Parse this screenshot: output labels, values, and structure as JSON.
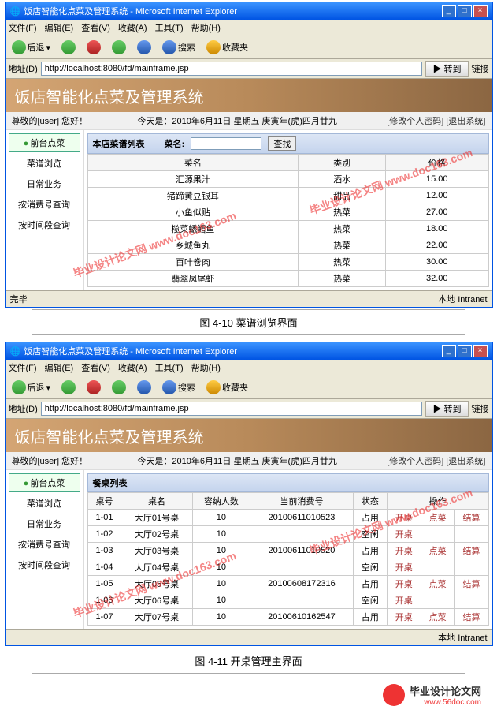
{
  "figure1": {
    "caption": "图 4-10 菜谱浏览界面",
    "window": {
      "title": "饭店智能化点菜及管理系统 - Microsoft Internet Explorer",
      "menu": [
        "文件(F)",
        "编辑(E)",
        "查看(V)",
        "收藏(A)",
        "工具(T)",
        "帮助(H)"
      ],
      "toolbar": {
        "back": "后退",
        "forward": "",
        "stop": "",
        "refresh": "",
        "home": "",
        "search": "搜索",
        "fav": "收藏夹"
      },
      "address_label": "地址(D)",
      "address": "http://localhost:8080/fd/mainframe.jsp",
      "go": "转到",
      "links": "链接",
      "status_left": "完毕",
      "status_right": "本地 Intranet"
    },
    "banner": "饭店智能化点菜及管理系统",
    "info": {
      "left": "尊敬的[user] 您好！",
      "center": "今天是：2010年6月11日 星期五 庚寅年(虎)四月廿九",
      "right_pwd": "[修改个人密码]",
      "right_exit": "[退出系统]"
    },
    "sidebar": [
      "前台点菜",
      "菜谱浏览",
      "日常业务",
      "按消费号查询",
      "按时间段查询"
    ],
    "panel": {
      "title": "本店菜谱列表",
      "search_label": "菜名:",
      "search_btn": "查找"
    },
    "table1": {
      "headers": [
        "菜名",
        "类别",
        "价格"
      ],
      "rows": [
        [
          "汇源果汁",
          "酒水",
          "15.00"
        ],
        [
          "猪蹄黄豆银耳",
          "甜品",
          "12.00"
        ],
        [
          "小鱼似贴",
          "热菜",
          "27.00"
        ],
        [
          "榄菜蟋鳕鱼",
          "热菜",
          "18.00"
        ],
        [
          "乡城鱼丸",
          "热菜",
          "22.00"
        ],
        [
          "百叶卷肉",
          "热菜",
          "30.00"
        ],
        [
          "翡翠凤尾虾",
          "热菜",
          "32.00"
        ]
      ]
    }
  },
  "figure2": {
    "caption": "图 4-11 开桌管理主界面",
    "window": {
      "title": "饭店智能化点菜及管理系统 - Microsoft Internet Explorer",
      "menu": [
        "文件(F)",
        "编辑(E)",
        "查看(V)",
        "收藏(A)",
        "工具(T)",
        "帮助(H)"
      ],
      "toolbar": {
        "back": "后退",
        "forward": "",
        "stop": "",
        "refresh": "",
        "home": "",
        "search": "搜索",
        "fav": "收藏夹"
      },
      "address_label": "地址(D)",
      "address": "http://localhost:8080/fd/mainframe.jsp",
      "go": "转到",
      "links": "链接",
      "status_left": "",
      "status_right": "本地 Intranet"
    },
    "banner": "饭店智能化点菜及管理系统",
    "info": {
      "left": "尊敬的[user] 您好！",
      "center": "今天是：2010年6月11日 星期五 庚寅年(虎)四月廿九",
      "right_pwd": "[修改个人密码]",
      "right_exit": "[退出系统]"
    },
    "sidebar": [
      "前台点菜",
      "菜谱浏览",
      "日常业务",
      "按消费号查询",
      "按时间段查询"
    ],
    "panel": {
      "title": "餐桌列表"
    },
    "table2": {
      "headers": [
        "桌号",
        "桌名",
        "容纳人数",
        "当前消费号",
        "状态",
        "操作",
        "",
        ""
      ],
      "rows": [
        [
          "1-01",
          "大厅01号桌",
          "10",
          "20100611010523",
          "占用",
          "开桌",
          "点菜",
          "结算"
        ],
        [
          "1-02",
          "大厅02号桌",
          "10",
          "",
          "空闲",
          "开桌",
          "",
          ""
        ],
        [
          "1-03",
          "大厅03号桌",
          "10",
          "20100611010520",
          "占用",
          "开桌",
          "点菜",
          "结算"
        ],
        [
          "1-04",
          "大厅04号桌",
          "10",
          "",
          "空闲",
          "开桌",
          "",
          ""
        ],
        [
          "1-05",
          "大厅05号桌",
          "10",
          "20100608172316",
          "占用",
          "开桌",
          "点菜",
          "结算"
        ],
        [
          "1-06",
          "大厅06号桌",
          "10",
          "",
          "空闲",
          "开桌",
          "",
          ""
        ],
        [
          "1-07",
          "大厅07号桌",
          "10",
          "20100610162547",
          "占用",
          "开桌",
          "点菜",
          "结算"
        ]
      ]
    }
  },
  "watermarks": {
    "w1": "毕业设计论文网\nwww.doc163.com",
    "w2": "毕业设计论文网\nwww.doc163.com"
  },
  "footer": {
    "text": "毕业设计论文网",
    "url": "www.56doc.com"
  }
}
